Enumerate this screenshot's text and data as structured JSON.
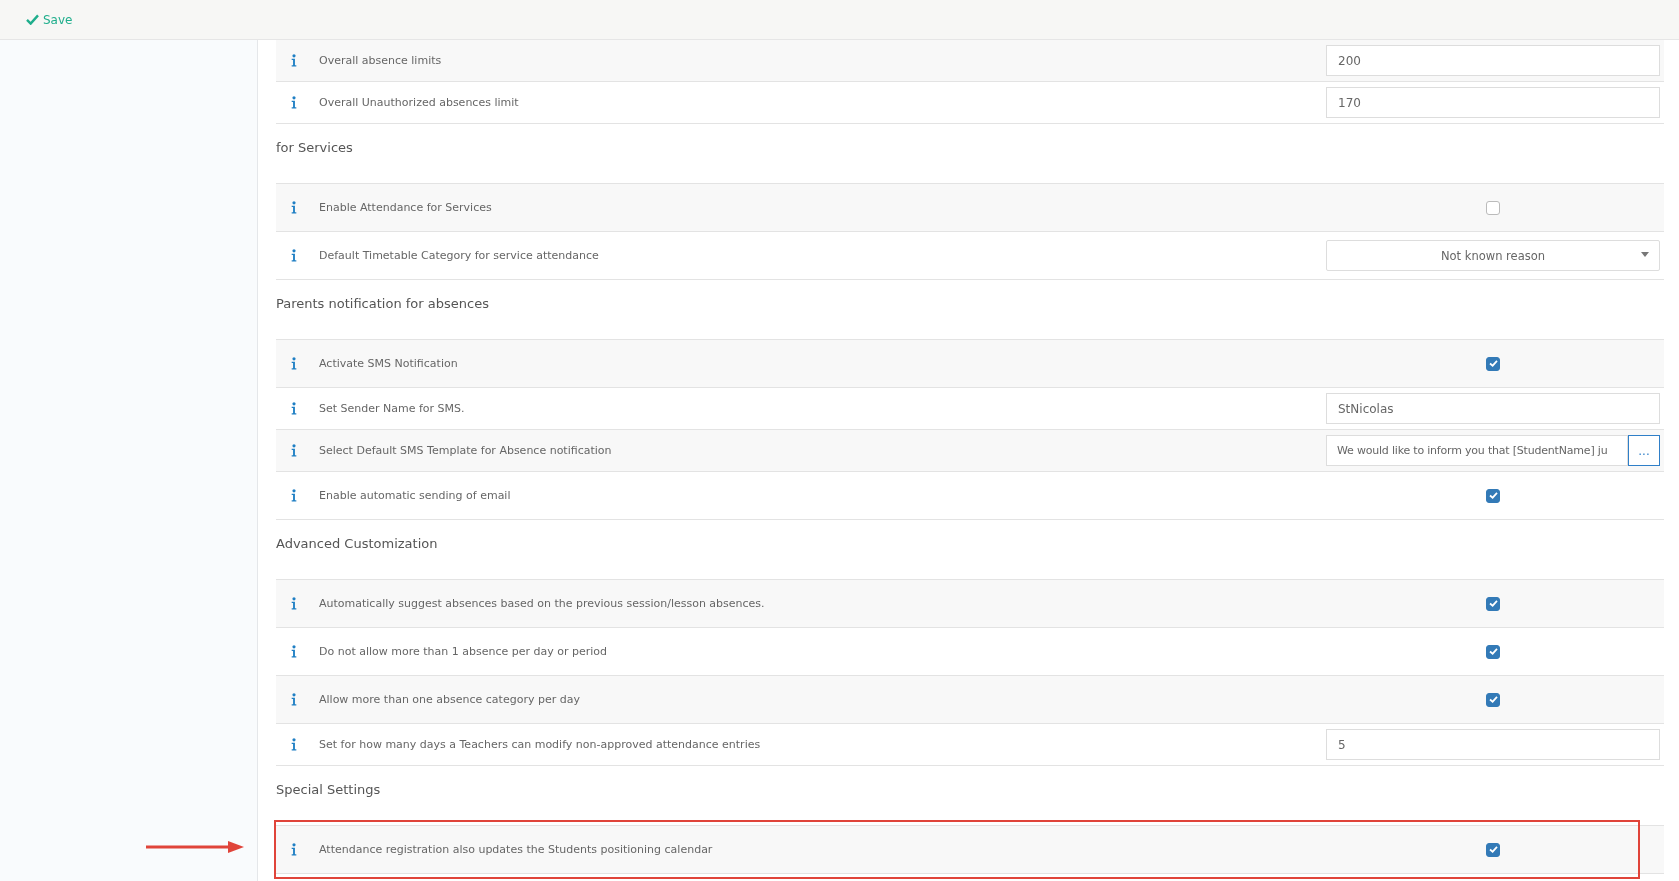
{
  "toolbar": {
    "save_label": "Save"
  },
  "sections": [
    {
      "rows": [
        {
          "kind": "input",
          "label": "Overall absence limits",
          "value": "200",
          "highlighted": false
        },
        {
          "kind": "input",
          "label": "Overall Unauthorized absences limit",
          "value": "170",
          "highlighted": false
        }
      ]
    },
    {
      "title": "for Services",
      "rows": [
        {
          "kind": "checkbox",
          "label": "Enable Attendance for Services",
          "checked": false,
          "highlighted": false
        },
        {
          "kind": "select",
          "label": "Default Timetable Category for service attendance",
          "value": "Not known reason",
          "highlighted": false
        }
      ]
    },
    {
      "title": "Parents notification for absences",
      "rows": [
        {
          "kind": "checkbox",
          "label": "Activate SMS Notification",
          "checked": true,
          "highlighted": false
        },
        {
          "kind": "input",
          "label": "Set Sender Name for SMS.",
          "value": "StNicolas",
          "highlighted": false
        },
        {
          "kind": "input_button",
          "label": "Select Default SMS Template for Absence notification",
          "value": "We would like to inform you that [StudentName] ju",
          "button": "...",
          "highlighted": false
        },
        {
          "kind": "checkbox",
          "label": "Enable automatic sending of email",
          "checked": true,
          "highlighted": false
        }
      ]
    },
    {
      "title": "Advanced Customization",
      "rows": [
        {
          "kind": "checkbox",
          "label": "Automatically suggest absences based on the previous session/lesson absences.",
          "checked": true,
          "highlighted": false
        },
        {
          "kind": "checkbox",
          "label": "Do not allow more than 1 absence per day or period",
          "checked": true,
          "highlighted": false
        },
        {
          "kind": "checkbox",
          "label": "Allow more than one absence category per day",
          "checked": true,
          "highlighted": false
        },
        {
          "kind": "input",
          "label": "Set for how many days a Teachers can modify non-approved attendance entries",
          "value": "5",
          "highlighted": false
        }
      ]
    },
    {
      "title": "Special Settings",
      "rows": [
        {
          "kind": "checkbox",
          "label": "Attendance registration also updates the Students positioning calendar",
          "checked": true,
          "highlighted": true
        }
      ]
    }
  ]
}
